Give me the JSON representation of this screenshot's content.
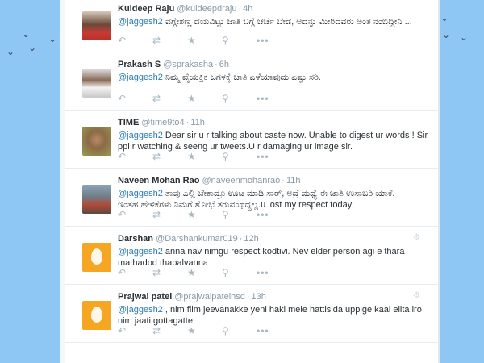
{
  "tweets": [
    {
      "name": "Kuldeep Raju",
      "handle": "@kuldeepdraju",
      "sep": "·",
      "time": "4h",
      "mention": "@jaggesh2",
      "text": " ವಗ್ಗೇಶಣ್ಣ ದಯವಿಟ್ಟು ಜಾತಿ ಬಗ್ಗೆ ಚರ್ಚೆ ಬೇಡ, ಅದನ್ನು ಮೀರಿದವರು ಅಂತ ನಂಬಿದ್ದೀನಿ ...",
      "avatar": "photo-red",
      "gear": false
    },
    {
      "name": "Prakash S",
      "handle": "@sprakasha",
      "sep": "·",
      "time": "6h",
      "mention": "@jaggesh2",
      "text": " ನಿಮ್ಮ ವೈಯಕ್ತಿಕ ಜಗಳಕ್ಕೆ ಜಾತಿ ಎಳೆಯಾವುದು ಎಷ್ಟು ಸರಿ.",
      "avatar": "photo-suit",
      "gear": false
    },
    {
      "name": "TIME",
      "handle": "@time9to4",
      "sep": "·",
      "time": "11h",
      "mention": "@jaggesh2",
      "text": " Dear sir u r talking about caste now. Unable to digest ur words ! Sir\nppl r watching & seeng ur tweets.U r damaging ur image sir.",
      "avatar": "photo-face",
      "gear": false
    },
    {
      "name": "Naveen Mohan Rao",
      "handle": "@naveenmohanrao",
      "sep": "·",
      "time": "11h",
      "mention": "@jaggesh2",
      "text": " ತಾವು ಎಲ್ಲಿ ಬೇಕಾದ್ರೂ ಊಟ ಮಾಡಿ ಸಾರ್, ಅದ್ರೆ ಮಧ್ಯೆ ಈ ಜಾತಿ ಉಸಾಬರಿ ಯಾಕೆ.\nಇಂತಹ ಹೇಳಿಕೆಗಳು ನಿಮಗೆ ಶೋಭೆ ತರುವಂಥದ್ದಲ್ಲ.u lost my respect today",
      "avatar": "photo-land",
      "gear": false
    },
    {
      "name": "Darshan",
      "handle": "@Darshankumar019",
      "sep": "·",
      "time": "12h",
      "mention": "@jaggesh2",
      "text": " anna nav nimgu respect kodtivi. Nev elder person agi e thara\nmathadod thapalvanna",
      "avatar": "egg",
      "gear": true
    },
    {
      "name": "Prajwal patel",
      "handle": "@prajwalpatelhsd",
      "sep": "·",
      "time": "13h",
      "mention": "@jaggesh2",
      "text": " , nim film jeevanakke yeni haki mele hattisida uppige kaal elita iro\nnim jaati gottagatte",
      "avatar": "egg",
      "gear": true
    }
  ],
  "icons": {
    "reply": "reply-icon",
    "retweet": "retweet-icon",
    "favorite": "star-icon",
    "follow": "follow-icon",
    "more": "more-icon",
    "gear": "gear-icon",
    "more_glyph": "•••"
  },
  "colors": {
    "background": "#8ec6f4",
    "mention": "#2b7bb9",
    "meta": "#8899a6",
    "egg": "#f5a623"
  }
}
